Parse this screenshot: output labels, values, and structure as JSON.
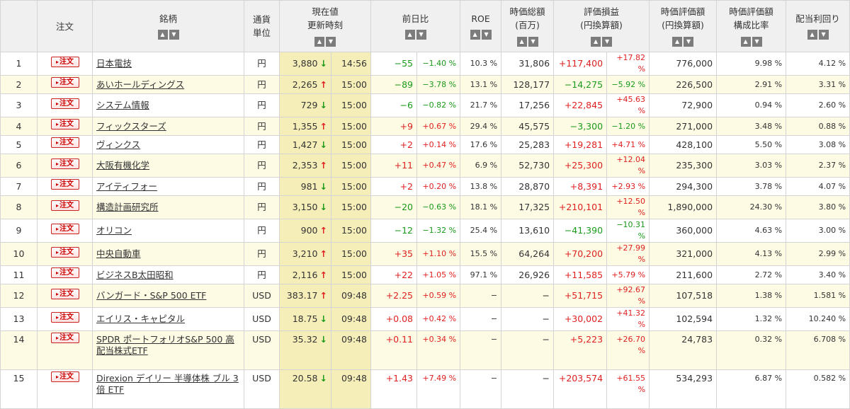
{
  "headers": {
    "no": "",
    "order": "注文",
    "name": "銘柄",
    "currency": "通貨\n単位",
    "price": "現在値\n更新時刻",
    "change": "前日比",
    "roe": "ROE",
    "mcap": "時価総額\n(百万)",
    "pl": "評価損益\n(円換算額)",
    "value": "時価評価額\n(円換算額)",
    "ratio": "時価評価額\n構成比率",
    "yield": "配当利回り"
  },
  "sort_icons": {
    "asc": "sort-ascending-icon",
    "desc": "sort-descending-icon"
  },
  "order_label": "注文",
  "colors": {
    "price_bg": "#f6eeb9",
    "even_row": "#fdfbe4",
    "up": "#e02020",
    "down": "#1a9a1a"
  },
  "rows": [
    {
      "no": "1",
      "name": "日本電技",
      "cur": "円",
      "price": "3,880",
      "arrow": "↓",
      "dir": "dn",
      "time": "14:56",
      "chg": "−55",
      "chgp": "−1.40 %",
      "cdir": "dn",
      "roe": "10.3 %",
      "mcap": "31,806",
      "pl": "+117,400",
      "plp": "+17.82 %",
      "pdir": "up",
      "value": "776,000",
      "ratio": "9.98 %",
      "yield": "4.12 %"
    },
    {
      "no": "2",
      "name": "あいホールディングス",
      "cur": "円",
      "price": "2,265",
      "arrow": "↑",
      "dir": "up",
      "time": "15:00",
      "chg": "−89",
      "chgp": "−3.78 %",
      "cdir": "dn",
      "roe": "13.1 %",
      "mcap": "128,177",
      "pl": "−14,275",
      "plp": "−5.92 %",
      "pdir": "dn",
      "value": "226,500",
      "ratio": "2.91 %",
      "yield": "3.31 %"
    },
    {
      "no": "3",
      "name": "システム情報",
      "cur": "円",
      "price": "729",
      "arrow": "↓",
      "dir": "dn",
      "time": "15:00",
      "chg": "−6",
      "chgp": "−0.82 %",
      "cdir": "dn",
      "roe": "21.7 %",
      "mcap": "17,256",
      "pl": "+22,845",
      "plp": "+45.63 %",
      "pdir": "up",
      "value": "72,900",
      "ratio": "0.94 %",
      "yield": "2.60 %"
    },
    {
      "no": "4",
      "name": "フィックスターズ",
      "cur": "円",
      "price": "1,355",
      "arrow": "↑",
      "dir": "up",
      "time": "15:00",
      "chg": "+9",
      "chgp": "+0.67 %",
      "cdir": "up",
      "roe": "29.4 %",
      "mcap": "45,575",
      "pl": "−3,300",
      "plp": "−1.20 %",
      "pdir": "dn",
      "value": "271,000",
      "ratio": "3.48 %",
      "yield": "0.88 %"
    },
    {
      "no": "5",
      "name": "ヴィンクス",
      "cur": "円",
      "price": "1,427",
      "arrow": "↓",
      "dir": "dn",
      "time": "15:00",
      "chg": "+2",
      "chgp": "+0.14 %",
      "cdir": "up",
      "roe": "17.6 %",
      "mcap": "25,283",
      "pl": "+19,281",
      "plp": "+4.71 %",
      "pdir": "up",
      "value": "428,100",
      "ratio": "5.50 %",
      "yield": "3.08 %"
    },
    {
      "no": "6",
      "name": "大阪有機化学",
      "cur": "円",
      "price": "2,353",
      "arrow": "↑",
      "dir": "up",
      "time": "15:00",
      "chg": "+11",
      "chgp": "+0.47 %",
      "cdir": "up",
      "roe": "6.9 %",
      "mcap": "52,730",
      "pl": "+25,300",
      "plp": "+12.04 %",
      "pdir": "up",
      "value": "235,300",
      "ratio": "3.03 %",
      "yield": "2.37 %"
    },
    {
      "no": "7",
      "name": "アイティフォー",
      "cur": "円",
      "price": "981",
      "arrow": "↓",
      "dir": "dn",
      "time": "15:00",
      "chg": "+2",
      "chgp": "+0.20 %",
      "cdir": "up",
      "roe": "13.8 %",
      "mcap": "28,870",
      "pl": "+8,391",
      "plp": "+2.93 %",
      "pdir": "up",
      "value": "294,300",
      "ratio": "3.78 %",
      "yield": "4.07 %"
    },
    {
      "no": "8",
      "name": "構造計画研究所",
      "cur": "円",
      "price": "3,150",
      "arrow": "↓",
      "dir": "dn",
      "time": "15:00",
      "chg": "−20",
      "chgp": "−0.63 %",
      "cdir": "dn",
      "roe": "18.1 %",
      "mcap": "17,325",
      "pl": "+210,101",
      "plp": "+12.50 %",
      "pdir": "up",
      "value": "1,890,000",
      "ratio": "24.30 %",
      "yield": "3.80 %"
    },
    {
      "no": "9",
      "name": "オリコン",
      "cur": "円",
      "price": "900",
      "arrow": "↑",
      "dir": "up",
      "time": "15:00",
      "chg": "−12",
      "chgp": "−1.32 %",
      "cdir": "dn",
      "roe": "25.4 %",
      "mcap": "13,610",
      "pl": "−41,390",
      "plp": "−10.31 %",
      "pdir": "dn",
      "value": "360,000",
      "ratio": "4.63 %",
      "yield": "3.00 %"
    },
    {
      "no": "10",
      "name": "中央自動車",
      "cur": "円",
      "price": "3,210",
      "arrow": "↑",
      "dir": "up",
      "time": "15:00",
      "chg": "+35",
      "chgp": "+1.10 %",
      "cdir": "up",
      "roe": "15.5 %",
      "mcap": "64,264",
      "pl": "+70,200",
      "plp": "+27.99 %",
      "pdir": "up",
      "value": "321,000",
      "ratio": "4.13 %",
      "yield": "2.99 %"
    },
    {
      "no": "11",
      "name": "ビジネスB太田昭和",
      "cur": "円",
      "price": "2,116",
      "arrow": "↑",
      "dir": "up",
      "time": "15:00",
      "chg": "+22",
      "chgp": "+1.05 %",
      "cdir": "up",
      "roe": "97.1 %",
      "mcap": "26,926",
      "pl": "+11,585",
      "plp": "+5.79 %",
      "pdir": "up",
      "value": "211,600",
      "ratio": "2.72 %",
      "yield": "3.40 %"
    },
    {
      "no": "12",
      "name": "バンガード・S&P 500 ETF",
      "cur": "USD",
      "price": "383.17",
      "arrow": "↑",
      "dir": "up",
      "time": "09:48",
      "chg": "+2.25",
      "chgp": "+0.59 %",
      "cdir": "up",
      "roe": "−",
      "mcap": "−",
      "pl": "+51,715",
      "plp": "+92.67 %",
      "pdir": "up",
      "value": "107,518",
      "ratio": "1.38 %",
      "yield": "1.581 %"
    },
    {
      "no": "13",
      "name": "エイリス・キャピタル",
      "cur": "USD",
      "price": "18.75",
      "arrow": "↓",
      "dir": "dn",
      "time": "09:48",
      "chg": "+0.08",
      "chgp": "+0.42 %",
      "cdir": "up",
      "roe": "−",
      "mcap": "−",
      "pl": "+30,002",
      "plp": "+41.32 %",
      "pdir": "up",
      "value": "102,594",
      "ratio": "1.32 %",
      "yield": "10.240 %"
    },
    {
      "no": "14",
      "name": "SPDR ポートフォリオS&P 500 高配当株式ETF",
      "cur": "USD",
      "price": "35.32",
      "arrow": "↓",
      "dir": "dn",
      "time": "09:48",
      "chg": "+0.11",
      "chgp": "+0.34 %",
      "cdir": "up",
      "roe": "−",
      "mcap": "−",
      "pl": "+5,223",
      "plp": "+26.70 %",
      "pdir": "up",
      "value": "24,783",
      "ratio": "0.32 %",
      "yield": "6.708 %",
      "tall": true
    },
    {
      "no": "15",
      "name": "Direxion デイリー 半導体株 ブル 3倍 ETF",
      "cur": "USD",
      "price": "20.58",
      "arrow": "↓",
      "dir": "dn",
      "time": "09:48",
      "chg": "+1.43",
      "chgp": "+7.49 %",
      "cdir": "up",
      "roe": "−",
      "mcap": "−",
      "pl": "+203,574",
      "plp": "+61.55 %",
      "pdir": "up",
      "value": "534,293",
      "ratio": "6.87 %",
      "yield": "0.582 %",
      "tall": true
    }
  ]
}
